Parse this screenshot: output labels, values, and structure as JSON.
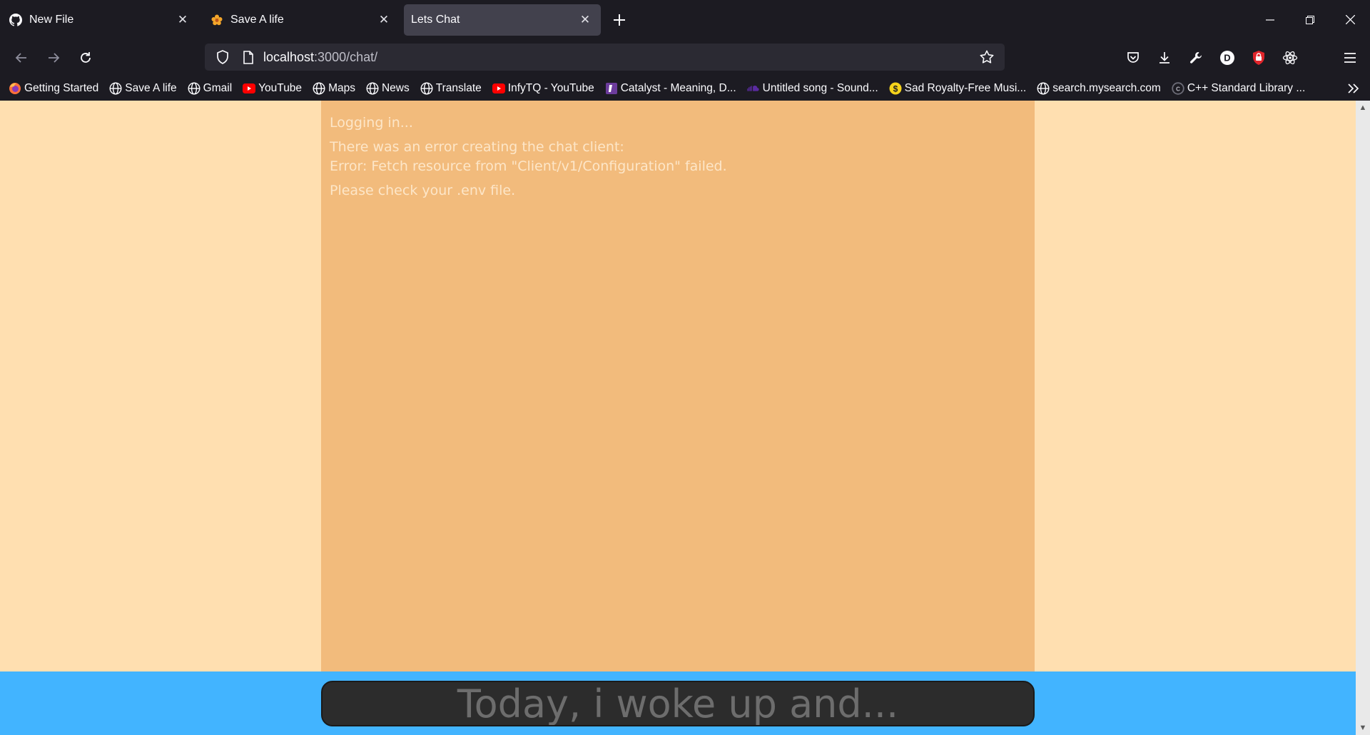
{
  "tabs": [
    {
      "title": "New File",
      "favicon": "github-icon",
      "active": false
    },
    {
      "title": "Save A life",
      "favicon": "flower-icon",
      "active": false
    },
    {
      "title": "Lets Chat",
      "favicon": "",
      "active": true
    }
  ],
  "url": {
    "host": "localhost",
    "path": ":3000/chat/"
  },
  "bookmarks": [
    {
      "label": "Getting Started",
      "icon": "firefox-icon"
    },
    {
      "label": "Save A life",
      "icon": "globe-icon"
    },
    {
      "label": "Gmail",
      "icon": "globe-icon"
    },
    {
      "label": "YouTube",
      "icon": "youtube-icon"
    },
    {
      "label": "Maps",
      "icon": "globe-icon"
    },
    {
      "label": "News",
      "icon": "globe-icon"
    },
    {
      "label": "Translate",
      "icon": "globe-icon"
    },
    {
      "label": "InfyTQ - YouTube",
      "icon": "youtube-icon"
    },
    {
      "label": "Catalyst - Meaning, D...",
      "icon": "catalyst-icon"
    },
    {
      "label": "Untitled song - Sound...",
      "icon": "soundcloud-icon"
    },
    {
      "label": "Sad Royalty-Free Musi...",
      "icon": "dollar-coin-icon"
    },
    {
      "label": "search.mysearch.com",
      "icon": "globe-icon"
    },
    {
      "label": "C++ Standard Library ...",
      "icon": "cpp-icon"
    }
  ],
  "chat": {
    "messages": [
      "Logging in...",
      "There was an error creating the chat client:",
      "Error: Fetch resource from \"Client/v1/Configuration\" failed.",
      "Please check your .env file."
    ],
    "input_placeholder": "Today, i woke up and..."
  },
  "colors": {
    "page_bg": "#ffdfb0",
    "chat_panel": "#f2bb7c",
    "composer_bar": "#42b4ff",
    "input_bg": "#2c2c2c"
  }
}
